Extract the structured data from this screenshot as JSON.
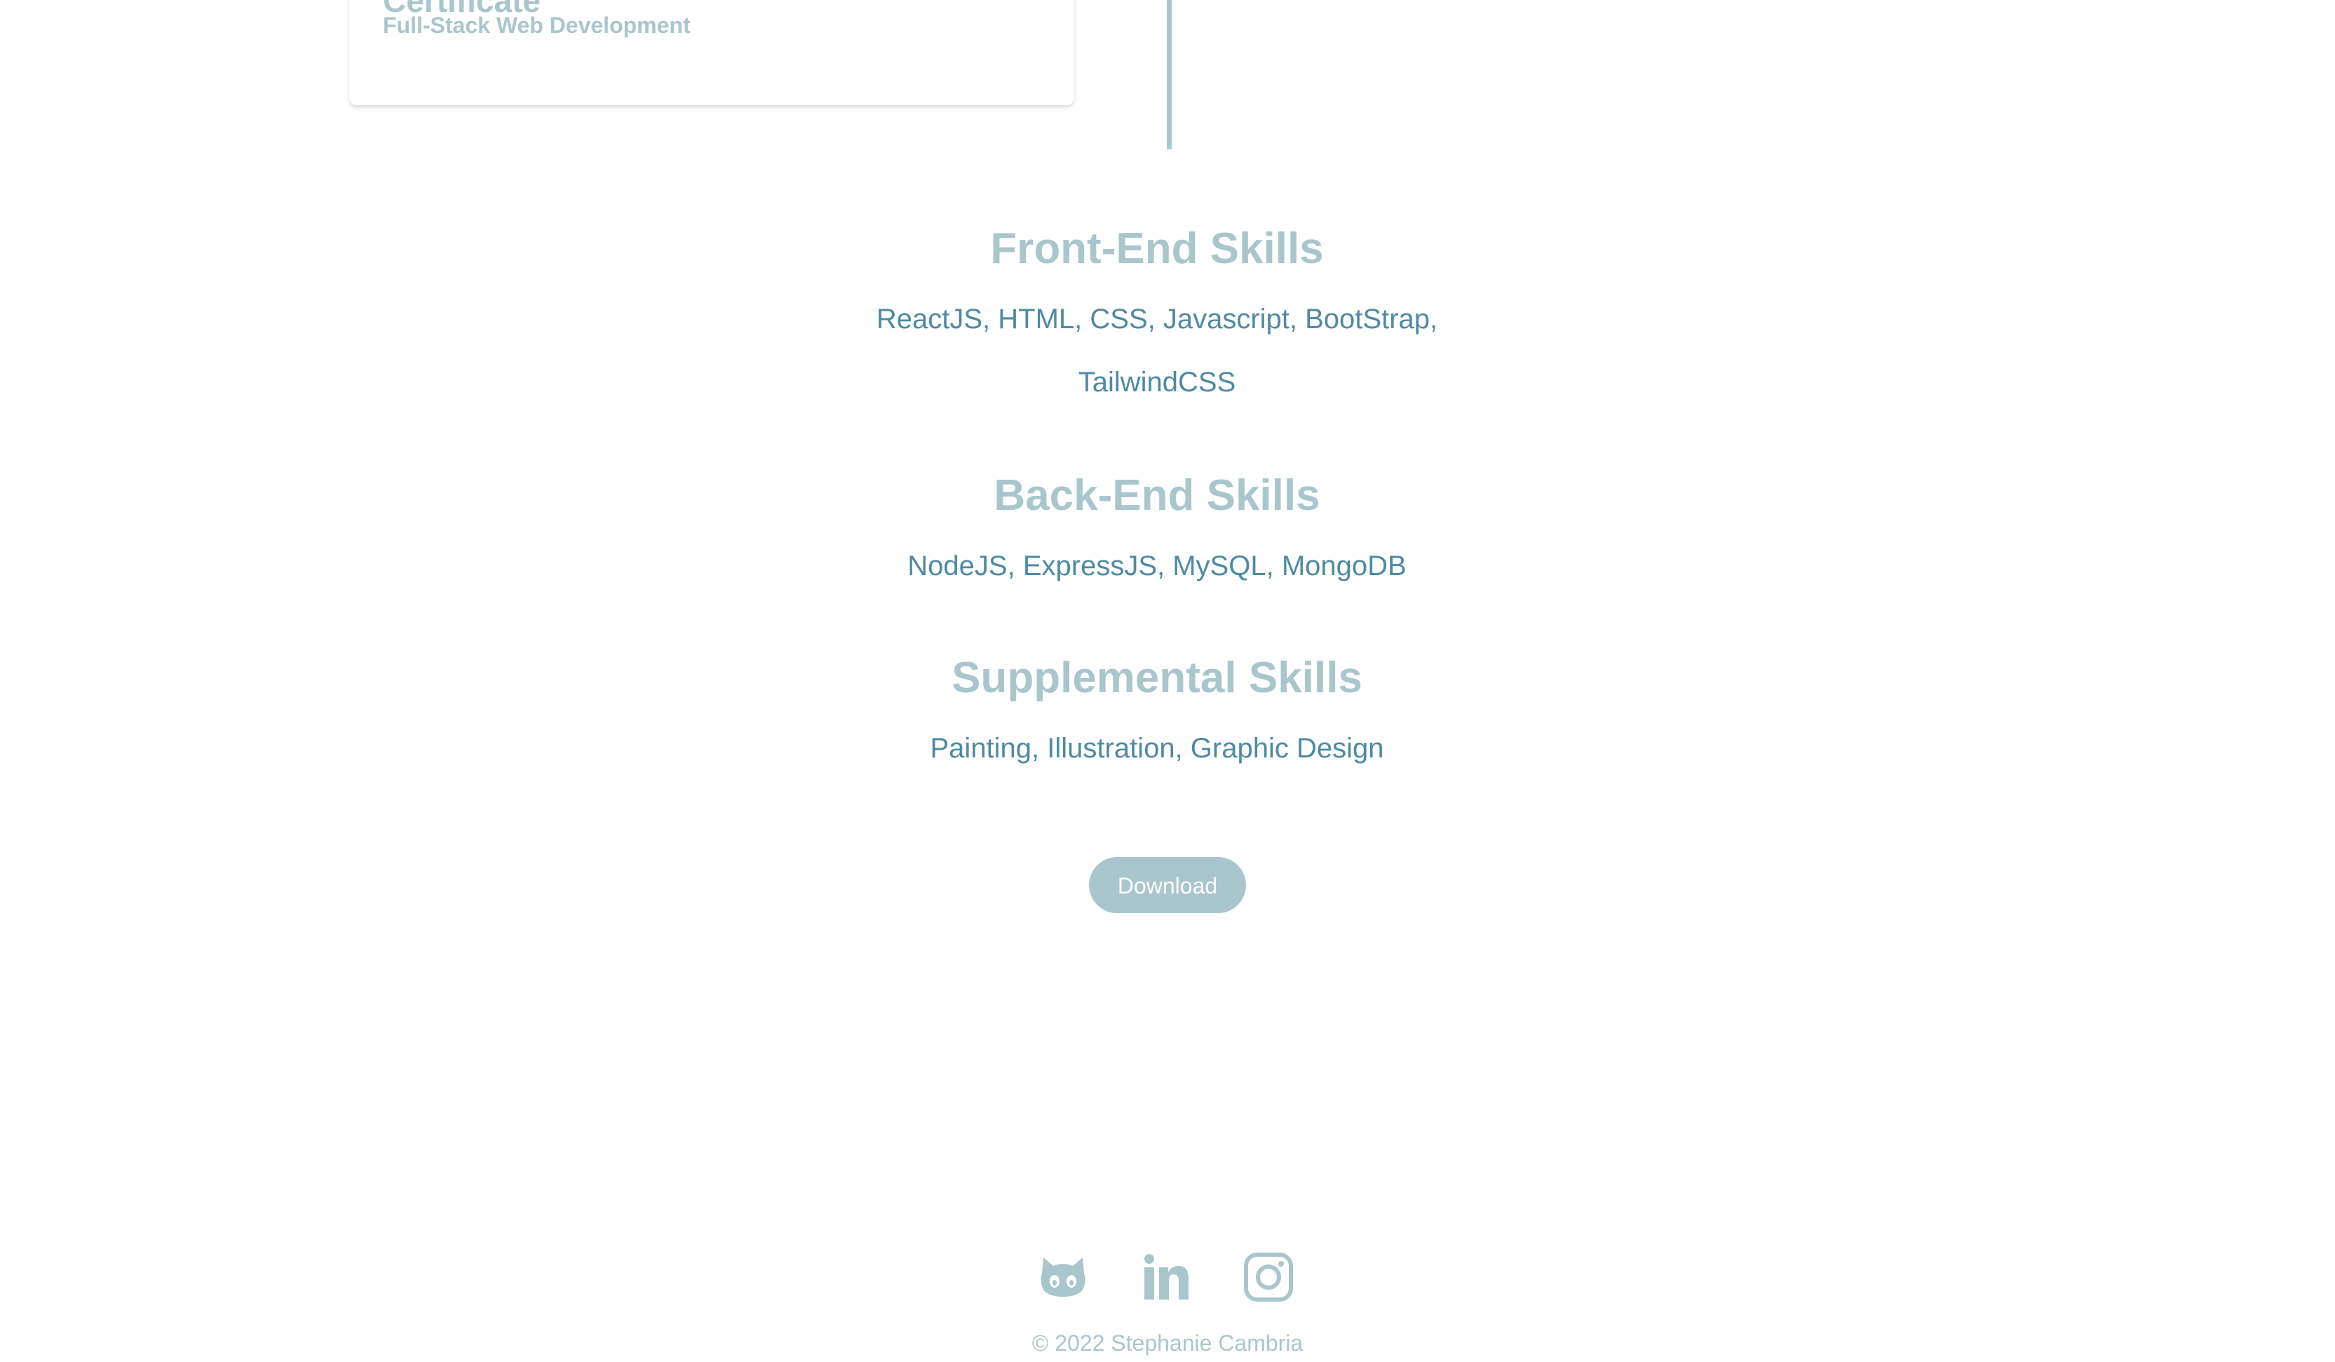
{
  "timeline_card": {
    "title": "Certificate",
    "subtitle": "Full-Stack Web Development"
  },
  "skills": {
    "front_end": {
      "heading": "Front-End Skills",
      "list": "ReactJS, HTML, CSS, Javascript, BootStrap, TailwindCSS"
    },
    "back_end": {
      "heading": "Back-End Skills",
      "list": "NodeJS, ExpressJS, MySQL, MongoDB"
    },
    "supplemental": {
      "heading": "Supplemental Skills",
      "list": "Painting, Illustration, Graphic Design"
    }
  },
  "download_button": {
    "label": "Download"
  },
  "footer": {
    "icons": [
      "github-icon",
      "linkedin-icon",
      "instagram-icon"
    ],
    "copyright": "© 2022 Stephanie Cambria"
  },
  "colors": {
    "heading": "#aac6cd",
    "skill_text": "#4f8aa3",
    "button_bg": "#aac6cd",
    "button_text": "#ffffff"
  }
}
